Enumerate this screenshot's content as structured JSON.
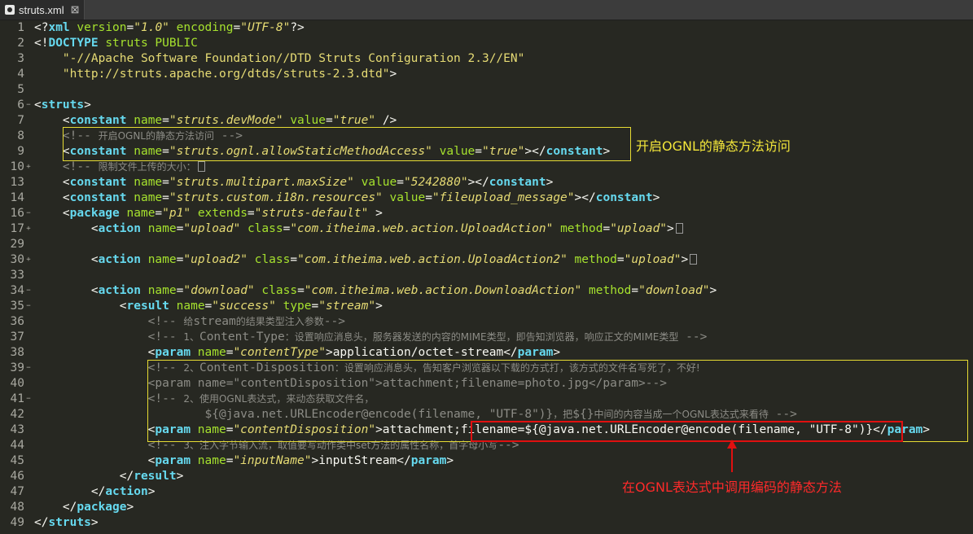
{
  "tab": {
    "title": "struts.xml",
    "close": "⊠"
  },
  "annotations": {
    "ognl_static": "开启OGNL的静态方法访问",
    "encode_static": "在OGNL表达式中调用编码的静态方法"
  },
  "lines": [
    {
      "n": "1",
      "tokens": [
        [
          "pun",
          "<?"
        ],
        [
          "tag",
          "xml"
        ],
        [
          "pun",
          " "
        ],
        [
          "attr",
          "version"
        ],
        [
          "pun",
          "="
        ],
        [
          "val",
          "\"1.0\""
        ],
        [
          "pun",
          " "
        ],
        [
          "attr",
          "encoding"
        ],
        [
          "pun",
          "="
        ],
        [
          "val",
          "\"UTF-8\""
        ],
        [
          "pun",
          "?>"
        ]
      ]
    },
    {
      "n": "2",
      "tokens": [
        [
          "pun",
          "<!"
        ],
        [
          "tag",
          "DOCTYPE"
        ],
        [
          "pun",
          " "
        ],
        [
          "attr",
          "struts PUBLIC"
        ]
      ]
    },
    {
      "n": "3",
      "tokens": [
        [
          "str",
          "    \"-//Apache Software Foundation//DTD Struts Configuration 2.3//EN\""
        ]
      ]
    },
    {
      "n": "4",
      "tokens": [
        [
          "str",
          "    \"http://struts.apache.org/dtds/struts-2.3.dtd\""
        ],
        [
          "pun",
          ">"
        ]
      ]
    },
    {
      "n": "5",
      "tokens": []
    },
    {
      "n": "6",
      "fold": "−",
      "tokens": [
        [
          "pun",
          "<"
        ],
        [
          "tag",
          "struts"
        ],
        [
          "pun",
          ">"
        ]
      ]
    },
    {
      "n": "7",
      "tokens": [
        [
          "pun",
          "    <"
        ],
        [
          "tag",
          "constant"
        ],
        [
          "pun",
          " "
        ],
        [
          "attr",
          "name"
        ],
        [
          "pun",
          "="
        ],
        [
          "val",
          "\"struts.devMode\""
        ],
        [
          "pun",
          " "
        ],
        [
          "attr",
          "value"
        ],
        [
          "pun",
          "="
        ],
        [
          "val",
          "\"true\""
        ],
        [
          "pun",
          " />"
        ]
      ]
    },
    {
      "n": "8",
      "tokens": [
        [
          "com",
          "    <!-- "
        ],
        [
          "comcjk",
          "开启OGNL的静态方法访问"
        ],
        [
          "com",
          " -->"
        ]
      ]
    },
    {
      "n": "9",
      "tokens": [
        [
          "pun",
          "    <"
        ],
        [
          "tag",
          "constant"
        ],
        [
          "pun",
          " "
        ],
        [
          "attr",
          "name"
        ],
        [
          "pun",
          "="
        ],
        [
          "val",
          "\"struts.ognl.allowStaticMethodAccess\""
        ],
        [
          "pun",
          " "
        ],
        [
          "attr",
          "value"
        ],
        [
          "pun",
          "="
        ],
        [
          "val",
          "\"true\""
        ],
        [
          "pun",
          "></"
        ],
        [
          "tag",
          "constant"
        ],
        [
          "pun",
          ">"
        ]
      ]
    },
    {
      "n": "10",
      "fold": "+",
      "tokens": [
        [
          "com",
          "    <!-- "
        ],
        [
          "comcjk",
          "限制文件上传的大小："
        ],
        [
          "dots",
          ""
        ]
      ]
    },
    {
      "n": "13",
      "tokens": [
        [
          "pun",
          "    <"
        ],
        [
          "tag",
          "constant"
        ],
        [
          "pun",
          " "
        ],
        [
          "attr",
          "name"
        ],
        [
          "pun",
          "="
        ],
        [
          "val",
          "\"struts.multipart.maxSize\""
        ],
        [
          "pun",
          " "
        ],
        [
          "attr",
          "value"
        ],
        [
          "pun",
          "="
        ],
        [
          "val",
          "\"5242880\""
        ],
        [
          "pun",
          "></"
        ],
        [
          "tag",
          "constant"
        ],
        [
          "pun",
          ">"
        ]
      ]
    },
    {
      "n": "14",
      "tokens": [
        [
          "pun",
          "    <"
        ],
        [
          "tag",
          "constant"
        ],
        [
          "pun",
          " "
        ],
        [
          "attr",
          "name"
        ],
        [
          "pun",
          "="
        ],
        [
          "val",
          "\"struts.custom.i18n.resources\""
        ],
        [
          "pun",
          " "
        ],
        [
          "attr",
          "value"
        ],
        [
          "pun",
          "="
        ],
        [
          "val",
          "\"fileupload_message\""
        ],
        [
          "pun",
          "></"
        ],
        [
          "tag",
          "constant"
        ],
        [
          "pun",
          ">"
        ]
      ]
    },
    {
      "n": "16",
      "fold": "−",
      "tokens": [
        [
          "pun",
          "    <"
        ],
        [
          "tag",
          "package"
        ],
        [
          "pun",
          " "
        ],
        [
          "attr",
          "name"
        ],
        [
          "pun",
          "="
        ],
        [
          "val",
          "\"p1\""
        ],
        [
          "pun",
          " "
        ],
        [
          "attr",
          "extends"
        ],
        [
          "pun",
          "="
        ],
        [
          "val",
          "\"struts-default\""
        ],
        [
          "pun",
          " >"
        ]
      ]
    },
    {
      "n": "17",
      "fold": "+",
      "tokens": [
        [
          "pun",
          "        <"
        ],
        [
          "tag",
          "action"
        ],
        [
          "pun",
          " "
        ],
        [
          "attr",
          "name"
        ],
        [
          "pun",
          "="
        ],
        [
          "val",
          "\"upload\""
        ],
        [
          "pun",
          " "
        ],
        [
          "attr",
          "class"
        ],
        [
          "pun",
          "="
        ],
        [
          "val",
          "\"com.itheima.web.action.UploadAction\""
        ],
        [
          "pun",
          " "
        ],
        [
          "attr",
          "method"
        ],
        [
          "pun",
          "="
        ],
        [
          "val",
          "\"upload\""
        ],
        [
          "pun",
          ">"
        ],
        [
          "dots",
          ""
        ]
      ]
    },
    {
      "n": "29",
      "tokens": []
    },
    {
      "n": "30",
      "fold": "+",
      "tokens": [
        [
          "pun",
          "        <"
        ],
        [
          "tag",
          "action"
        ],
        [
          "pun",
          " "
        ],
        [
          "attr",
          "name"
        ],
        [
          "pun",
          "="
        ],
        [
          "val",
          "\"upload2\""
        ],
        [
          "pun",
          " "
        ],
        [
          "attr",
          "class"
        ],
        [
          "pun",
          "="
        ],
        [
          "val",
          "\"com.itheima.web.action.UploadAction2\""
        ],
        [
          "pun",
          " "
        ],
        [
          "attr",
          "method"
        ],
        [
          "pun",
          "="
        ],
        [
          "val",
          "\"upload\""
        ],
        [
          "pun",
          ">"
        ],
        [
          "dots",
          ""
        ]
      ]
    },
    {
      "n": "33",
      "tokens": []
    },
    {
      "n": "34",
      "fold": "−",
      "tokens": [
        [
          "pun",
          "        <"
        ],
        [
          "tag",
          "action"
        ],
        [
          "pun",
          " "
        ],
        [
          "attr",
          "name"
        ],
        [
          "pun",
          "="
        ],
        [
          "val",
          "\"download\""
        ],
        [
          "pun",
          " "
        ],
        [
          "attr",
          "class"
        ],
        [
          "pun",
          "="
        ],
        [
          "val",
          "\"com.itheima.web.action.DownloadAction\""
        ],
        [
          "pun",
          " "
        ],
        [
          "attr",
          "method"
        ],
        [
          "pun",
          "="
        ],
        [
          "val",
          "\"download\""
        ],
        [
          "pun",
          ">"
        ]
      ]
    },
    {
      "n": "35",
      "fold": "−",
      "tokens": [
        [
          "pun",
          "            <"
        ],
        [
          "tag",
          "result"
        ],
        [
          "pun",
          " "
        ],
        [
          "attr",
          "name"
        ],
        [
          "pun",
          "="
        ],
        [
          "val",
          "\"success\""
        ],
        [
          "pun",
          " "
        ],
        [
          "attr",
          "type"
        ],
        [
          "pun",
          "="
        ],
        [
          "val",
          "\"stream\""
        ],
        [
          "pun",
          ">"
        ]
      ]
    },
    {
      "n": "36",
      "tokens": [
        [
          "com",
          "                <!-- "
        ],
        [
          "comcjk",
          "给"
        ],
        [
          "com",
          "stream"
        ],
        [
          "comcjk",
          "的结果类型注入参数"
        ],
        [
          "com",
          "-->"
        ]
      ]
    },
    {
      "n": "37",
      "tokens": [
        [
          "com",
          "                <!-- "
        ],
        [
          "comcjk",
          "1、"
        ],
        [
          "com",
          "Content-Type"
        ],
        [
          "comcjk",
          "：设置响应消息头，服务器发送的内容的MIME类型，即告知浏览器，响应正文的MIME类型"
        ],
        [
          "com",
          " -->"
        ]
      ]
    },
    {
      "n": "38",
      "tokens": [
        [
          "pun",
          "                <"
        ],
        [
          "tag",
          "param"
        ],
        [
          "pun",
          " "
        ],
        [
          "attr",
          "name"
        ],
        [
          "pun",
          "="
        ],
        [
          "val",
          "\"contentType\""
        ],
        [
          "pun",
          ">"
        ],
        [
          "text",
          "application/octet-stream"
        ],
        [
          "pun",
          "</"
        ],
        [
          "tag",
          "param"
        ],
        [
          "pun",
          ">"
        ]
      ]
    },
    {
      "n": "39",
      "fold": "−",
      "tokens": [
        [
          "com",
          "                <!-- "
        ],
        [
          "comcjk",
          "2、"
        ],
        [
          "com",
          "Content-Disposition"
        ],
        [
          "comcjk",
          "：设置响应消息头，告知客户浏览器以下载的方式打，该方式的文件名写死了，不好!"
        ]
      ]
    },
    {
      "n": "40",
      "tokens": [
        [
          "com",
          "                <param name=\"contentDisposition\">attachment;filename=photo.jpg</param>-->"
        ]
      ]
    },
    {
      "n": "41",
      "fold": "−",
      "tokens": [
        [
          "com",
          "                <!-- "
        ],
        [
          "comcjk",
          "2、使用OGNL表达式，来动态获取文件名，"
        ]
      ]
    },
    {
      "n": "42",
      "tokens": [
        [
          "com",
          "                        ${@java.net.URLEncoder@encode(filename, \"UTF-8\")}"
        ],
        [
          "comcjk",
          "，把"
        ],
        [
          "com",
          "${}"
        ],
        [
          "comcjk",
          "中间的内容当成一个OGNL表达式来看待"
        ],
        [
          "com",
          " -->"
        ]
      ]
    },
    {
      "n": "43",
      "tokens": [
        [
          "pun",
          "                <"
        ],
        [
          "tag",
          "param"
        ],
        [
          "pun",
          " "
        ],
        [
          "attr",
          "name"
        ],
        [
          "pun",
          "="
        ],
        [
          "val",
          "\"contentDisposition\""
        ],
        [
          "pun",
          ">"
        ],
        [
          "text",
          "attachment;filename=${@java.net.URLEncoder@encode(filename, \"UTF-8\")}"
        ],
        [
          "pun",
          "</"
        ],
        [
          "tag",
          "param"
        ],
        [
          "pun",
          ">"
        ]
      ]
    },
    {
      "n": "44",
      "tokens": [
        [
          "com",
          "                <!-- "
        ],
        [
          "comcjk",
          "3、注入字节输入流，取值要写动作类中set方法的属性名称，首字母小写"
        ],
        [
          "com",
          "-->"
        ]
      ]
    },
    {
      "n": "45",
      "tokens": [
        [
          "pun",
          "                <"
        ],
        [
          "tag",
          "param"
        ],
        [
          "pun",
          " "
        ],
        [
          "attr",
          "name"
        ],
        [
          "pun",
          "="
        ],
        [
          "val",
          "\"inputName\""
        ],
        [
          "pun",
          ">"
        ],
        [
          "text",
          "inputStream"
        ],
        [
          "pun",
          "</"
        ],
        [
          "tag",
          "param"
        ],
        [
          "pun",
          ">"
        ]
      ]
    },
    {
      "n": "46",
      "tokens": [
        [
          "pun",
          "            </"
        ],
        [
          "tag",
          "result"
        ],
        [
          "pun",
          ">"
        ]
      ]
    },
    {
      "n": "47",
      "tokens": [
        [
          "pun",
          "        </"
        ],
        [
          "tag",
          "action"
        ],
        [
          "pun",
          ">"
        ]
      ]
    },
    {
      "n": "48",
      "tokens": [
        [
          "pun",
          "    </"
        ],
        [
          "tag",
          "package"
        ],
        [
          "pun",
          ">"
        ]
      ]
    },
    {
      "n": "49",
      "tokens": [
        [
          "pun",
          "</"
        ],
        [
          "tag",
          "struts"
        ],
        [
          "pun",
          ">"
        ]
      ]
    }
  ]
}
